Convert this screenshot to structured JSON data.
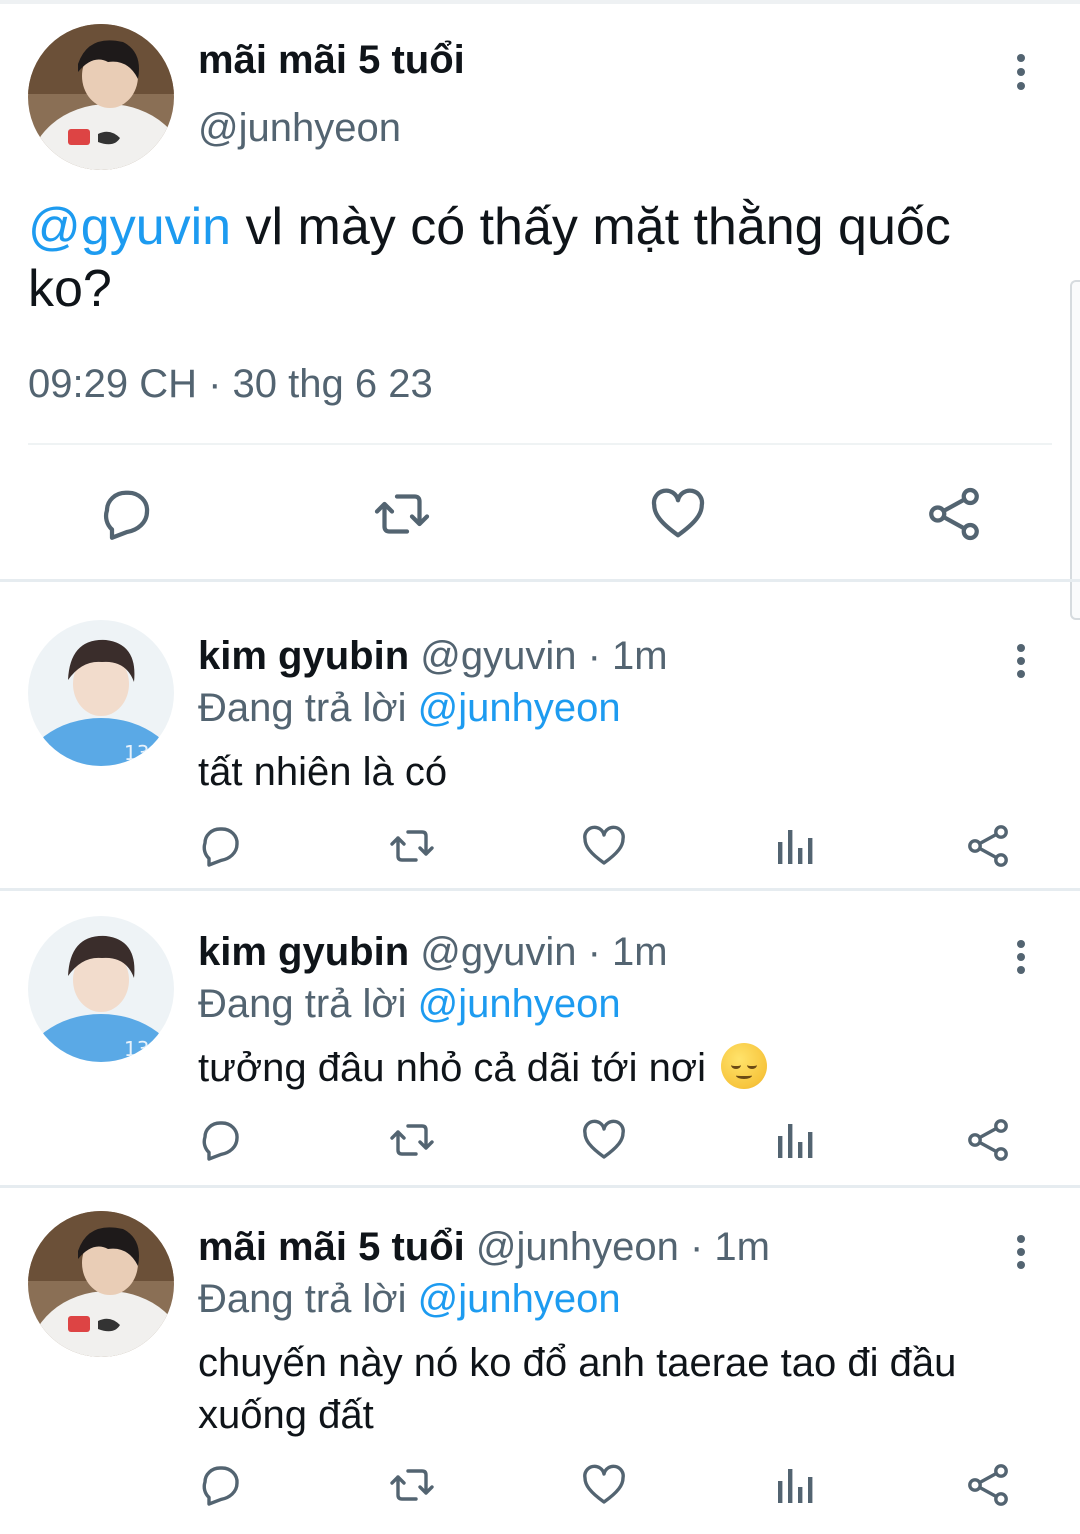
{
  "colors": {
    "accent": "#1d9bf0",
    "text": "#0f1419",
    "secondary": "#536471",
    "icon": "#536471"
  },
  "main_tweet": {
    "name": "mãi mãi 5 tuổi",
    "handle": "@junhyeon",
    "mention": "@gyuvin",
    "text": " vl mày có thấy mặt thằng quốc ko?",
    "timestamp": "09:29 CH · 30 thg 6 23",
    "actions": [
      "reply-icon",
      "retweet-icon",
      "like-icon",
      "share-icon"
    ]
  },
  "replies": [
    {
      "name": "kim gyubin",
      "handle": "@gyuvin",
      "time": " · 1m",
      "replying_prefix": "Đang trả lời ",
      "replying_to": "@junhyeon",
      "text": "tất nhiên là có",
      "emoji": ""
    },
    {
      "name": "kim gyubin",
      "handle": "@gyuvin",
      "time": " · 1m",
      "replying_prefix": "Đang trả lời ",
      "replying_to": "@junhyeon",
      "text": "tưởng đâu nhỏ cả dãi tới nơi ",
      "emoji": "relieved-face"
    },
    {
      "name": "mãi mãi 5 tuổi",
      "handle": "@junhyeon",
      "time": " · 1m",
      "replying_prefix": "Đang trả lời ",
      "replying_to": "@junhyeon",
      "text": "chuyến này nó ko đổ anh taerae tao đi đầu xuống đất",
      "emoji": ""
    }
  ]
}
